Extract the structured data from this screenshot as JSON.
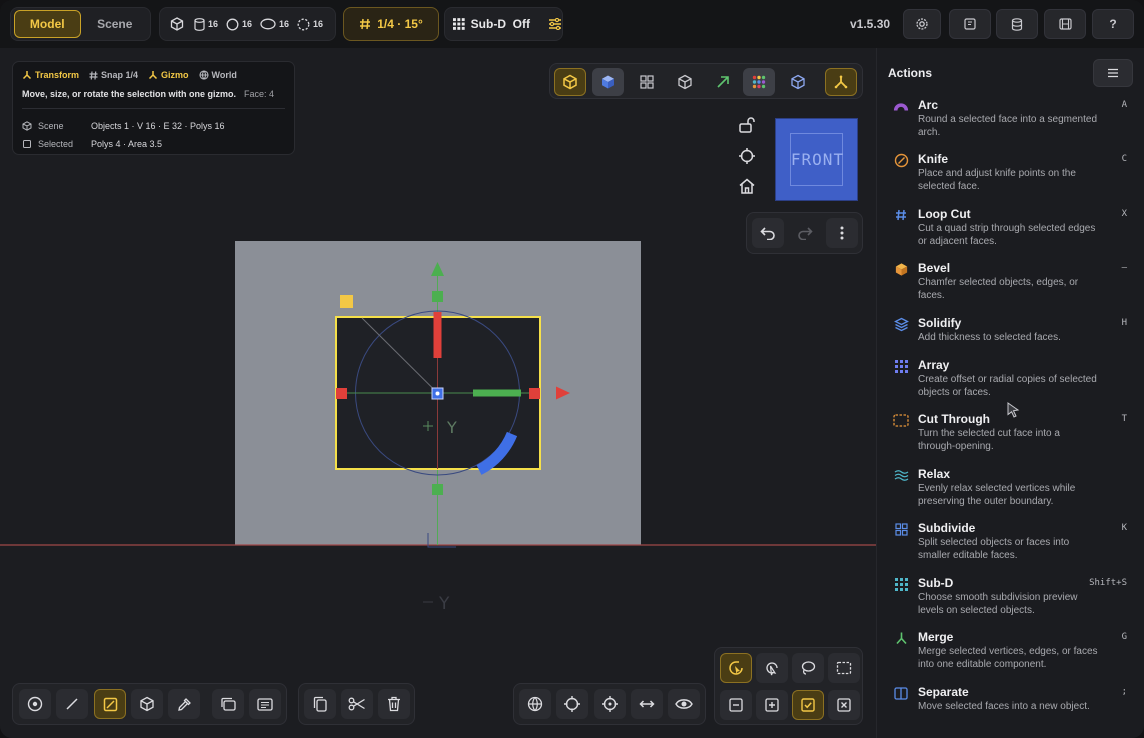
{
  "header": {
    "modes": [
      {
        "label": "Model",
        "active": true
      },
      {
        "label": "Scene",
        "active": false
      }
    ],
    "stats": [
      "16",
      "16",
      "16",
      "16"
    ],
    "snap": "1/4 · 15°",
    "subd": "Sub-D  Off",
    "version": "v1.5.30"
  },
  "info": {
    "chips": [
      "Transform",
      "Snap 1/4",
      "Gizmo",
      "World"
    ],
    "description": "Move, size, or rotate the selection with one gizmo.",
    "face": "Face: 4",
    "rows": [
      {
        "key": "Scene",
        "value": "Objects 1 · V 16 · E 32 · Polys 16"
      },
      {
        "key": "Selected",
        "value": "Polys 4 · Area 3.5"
      }
    ]
  },
  "viewcube": {
    "label": "FRONT"
  },
  "axes": {
    "y_label": "Y"
  },
  "actions": {
    "title": "Actions",
    "items": [
      {
        "name": "Arc",
        "desc": "Round a selected face into a segmented arch.",
        "key": "A",
        "icon": "arc-icon",
        "color": "#9b59d0"
      },
      {
        "name": "Knife",
        "desc": "Place and adjust knife points on the selected face.",
        "key": "C",
        "icon": "knife-icon",
        "color": "#e6953a"
      },
      {
        "name": "Loop Cut",
        "desc": "Cut a quad strip through selected edges or adjacent faces.",
        "key": "X",
        "icon": "hash-icon",
        "color": "#5b8de8"
      },
      {
        "name": "Bevel",
        "desc": "Chamfer selected objects, edges, or faces.",
        "key": "–",
        "icon": "cube-icon",
        "color": "#e6953a"
      },
      {
        "name": "Solidify",
        "desc": "Add thickness to selected faces.",
        "key": "H",
        "icon": "layers-icon",
        "color": "#5b8de8"
      },
      {
        "name": "Array",
        "desc": "Create offset or radial copies of selected objects or faces.",
        "key": "",
        "icon": "grid-icon",
        "color": "#6f7df0"
      },
      {
        "name": "Cut Through",
        "desc": "Turn the selected cut face into a through-opening.",
        "key": "T",
        "icon": "dashed-rect-icon",
        "color": "#e6953a"
      },
      {
        "name": "Relax",
        "desc": "Evenly relax selected vertices while preserving the outer boundary.",
        "key": "",
        "icon": "wave-icon",
        "color": "#4fb6c9"
      },
      {
        "name": "Subdivide",
        "desc": "Split selected objects or faces into smaller editable faces.",
        "key": "K",
        "icon": "quad-grid-icon",
        "color": "#5b8de8"
      },
      {
        "name": "Sub-D",
        "desc": "Choose smooth subdivision preview levels on selected objects.",
        "key": "Shift+S",
        "icon": "dot-grid-icon",
        "color": "#4fb6c9"
      },
      {
        "name": "Merge",
        "desc": "Merge selected vertices, edges, or faces into one editable component.",
        "key": "G",
        "icon": "merge-icon",
        "color": "#5fc46f"
      },
      {
        "name": "Separate",
        "desc": "Move selected faces into a new object.",
        "key": ";",
        "icon": "split-icon",
        "color": "#5b8de8"
      }
    ]
  },
  "colors": {
    "accent": "#f3c846",
    "x_axis": "#e0403a",
    "y_axis": "#4caf50",
    "z_axis": "#3f6fe6",
    "selection": "#f5e04a"
  }
}
